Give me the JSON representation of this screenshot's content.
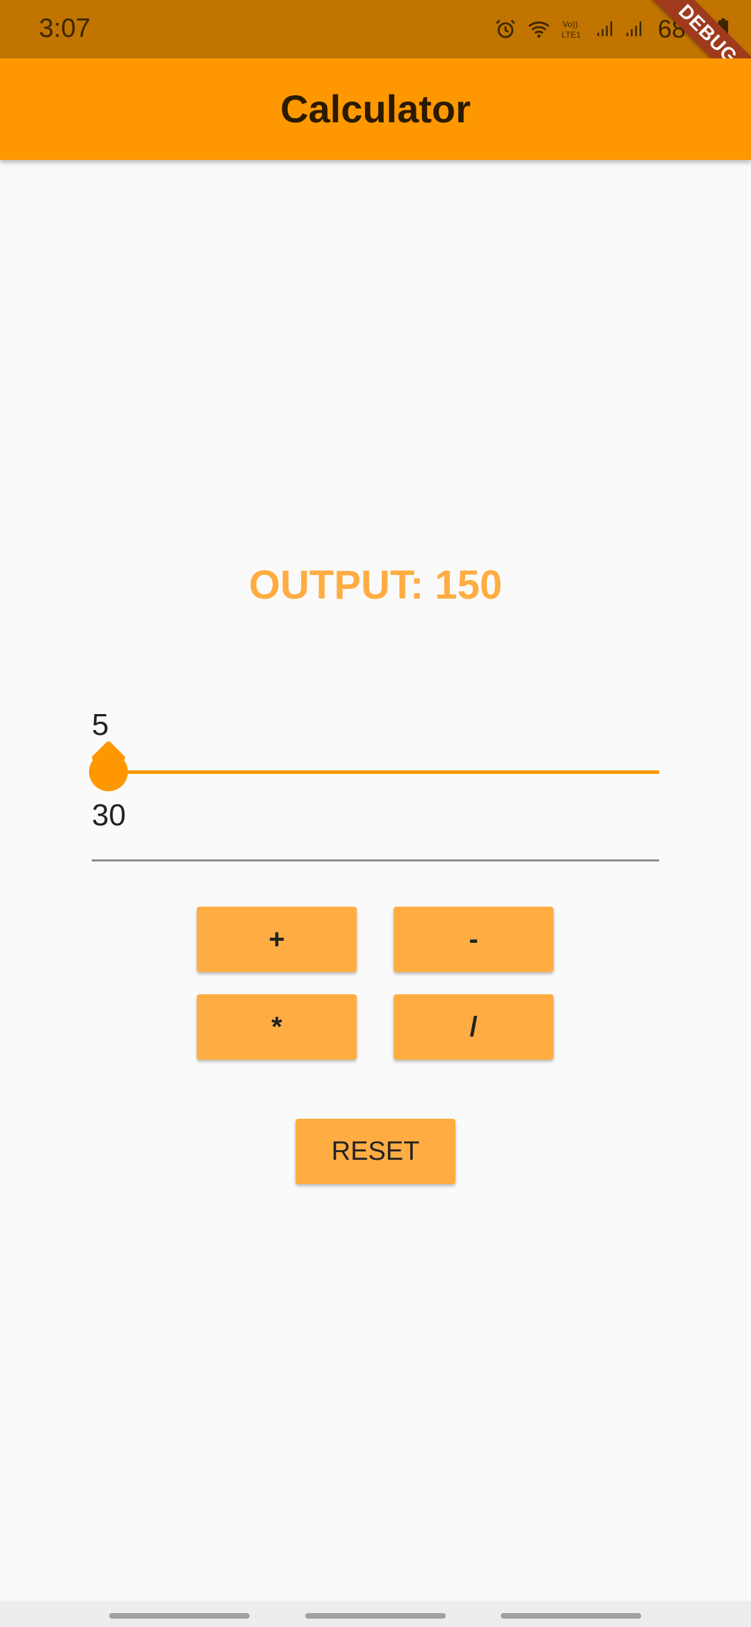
{
  "status_bar": {
    "time": "3:07",
    "battery": "68%",
    "icons": [
      "alarm-icon",
      "wifi-icon",
      "volte-icon",
      "signal-icon",
      "signal-icon-2",
      "battery-icon"
    ]
  },
  "debug_banner": "DEBUG",
  "app_bar": {
    "title": "Calculator"
  },
  "output": {
    "text": "OUTPUT: 150"
  },
  "slider": {
    "value_label": "5",
    "value": 5
  },
  "number_input": {
    "value": "30"
  },
  "operations": {
    "add": "+",
    "subtract": "-",
    "multiply": "*",
    "divide": "/"
  },
  "reset_label": "RESET",
  "colors": {
    "accent": "#ff9800",
    "button": "#ffad43",
    "status_bar": "#c17400"
  }
}
